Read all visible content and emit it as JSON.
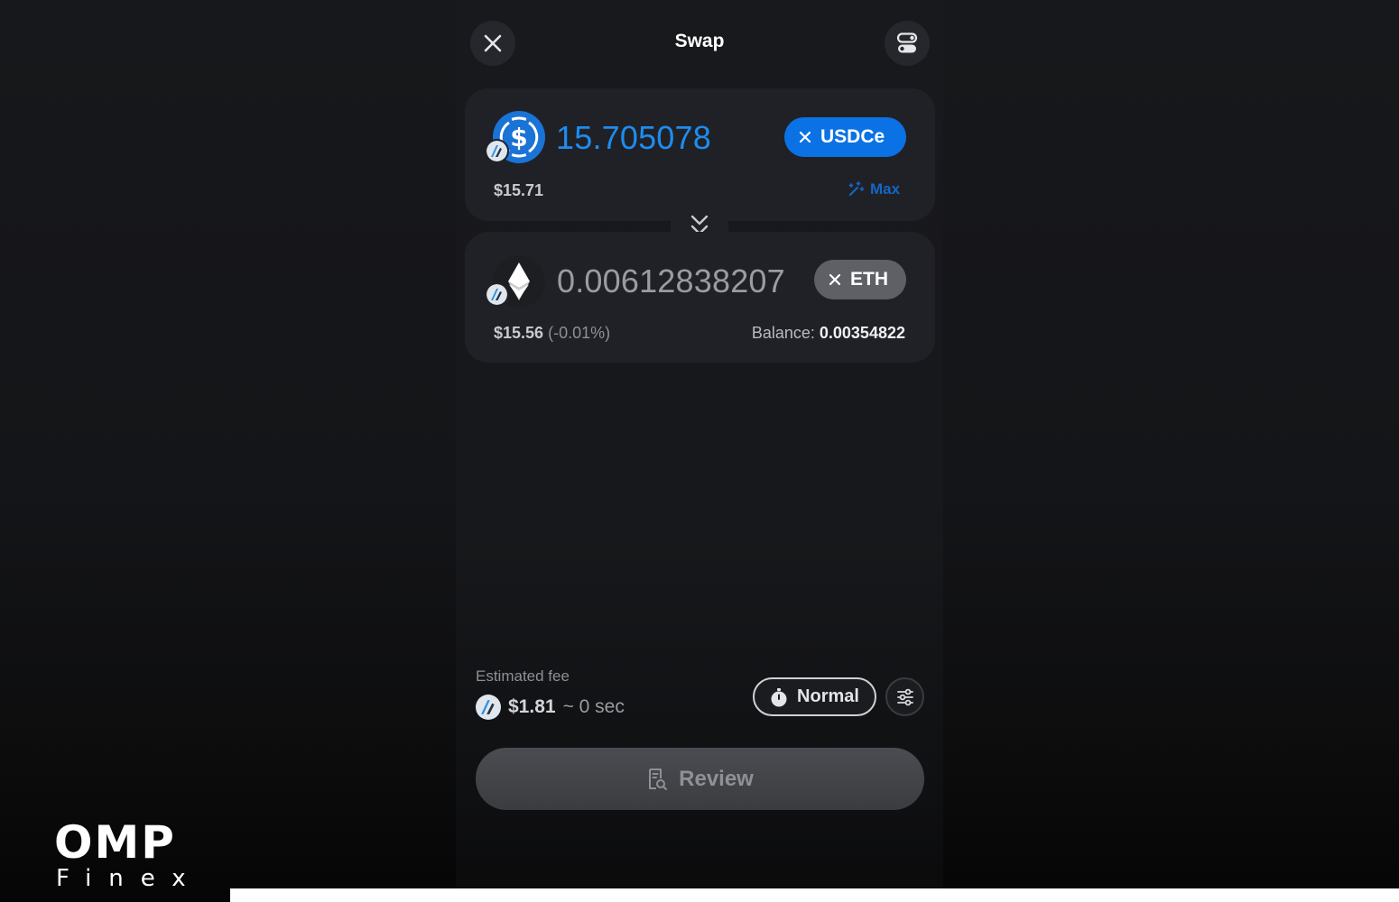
{
  "header": {
    "title": "Swap",
    "close_icon": "close-icon",
    "settings_icon": "toggle-settings-icon"
  },
  "from_token": {
    "amount": "15.705078",
    "symbol": "USDCe",
    "usd_value": "$15.71",
    "max_label": "Max",
    "icon": "usdc-icon",
    "chain_icon": "arbitrum-icon",
    "accent_color": "#0a72e4"
  },
  "to_token": {
    "amount": "0.00612838207",
    "symbol": "ETH",
    "usd_value": "$15.56",
    "price_change": "(-0.01%)",
    "balance_label": "Balance:",
    "balance_value": "0.00354822",
    "icon": "eth-icon",
    "chain_icon": "arbitrum-icon"
  },
  "flip_icon": "chevrons-down-icon",
  "fee": {
    "label": "Estimated fee",
    "value": "$1.81",
    "time": "~ 0 sec",
    "speed_label": "Normal",
    "speed_icon": "stopwatch-icon",
    "settings_icon": "sliders-icon"
  },
  "review": {
    "label": "Review",
    "icon": "receipt-search-icon"
  },
  "watermark": {
    "main": "OMP",
    "sub": "Finex"
  }
}
